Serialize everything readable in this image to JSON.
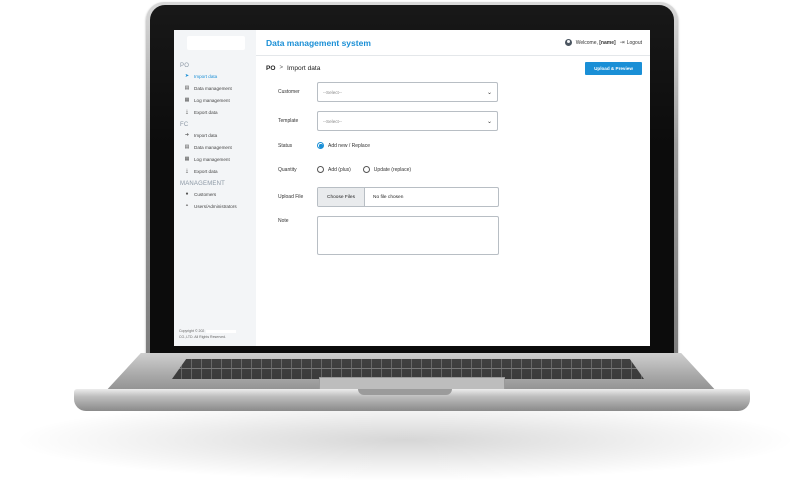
{
  "app": {
    "title": "Data management system"
  },
  "header": {
    "welcome_prefix": "Welcome,",
    "user_name": "[name]",
    "logout_label": "Logout"
  },
  "sidebar": {
    "sections": [
      {
        "title": "PO",
        "items": [
          {
            "label": "Import data",
            "icon": "arrow-right-icon",
            "active": true
          },
          {
            "label": "Data management",
            "icon": "document-icon"
          },
          {
            "label": "Log management",
            "icon": "log-icon"
          },
          {
            "label": "Export data",
            "icon": "download-icon"
          }
        ]
      },
      {
        "title": "FC",
        "items": [
          {
            "label": "Import data",
            "icon": "import-icon"
          },
          {
            "label": "Data management",
            "icon": "document-icon"
          },
          {
            "label": "Log management",
            "icon": "log-icon"
          },
          {
            "label": "Export data",
            "icon": "download-icon"
          }
        ]
      },
      {
        "title": "MANAGEMENT",
        "items": [
          {
            "label": "Customers",
            "icon": "user-icon"
          },
          {
            "label": "Users/Administrators",
            "icon": "users-icon"
          }
        ]
      }
    ],
    "footer": {
      "line1": "Copyright © 202",
      "line2": "CO.,LTD. All Rights Reserved."
    }
  },
  "breadcrumb": {
    "root": "PO",
    "separator": ">",
    "current": "Import data"
  },
  "actions": {
    "upload_preview": "Upload & Preview"
  },
  "form": {
    "customer": {
      "label": "Customer",
      "placeholder": "--Select--"
    },
    "template": {
      "label": "Template",
      "placeholder": "--Select--"
    },
    "status": {
      "label": "Status",
      "option": "Add new / Replace",
      "selected": true
    },
    "quantity": {
      "label": "Quantity",
      "options": [
        "Add (plus)",
        "Update (replace)"
      ],
      "selected": null
    },
    "upload": {
      "label": "Upload File",
      "button": "Choose Files",
      "value": "No file chosen"
    },
    "note": {
      "label": "Note",
      "value": ""
    }
  },
  "colors": {
    "accent": "#1a8fd6",
    "sidebar_bg": "#f3f5f7"
  }
}
